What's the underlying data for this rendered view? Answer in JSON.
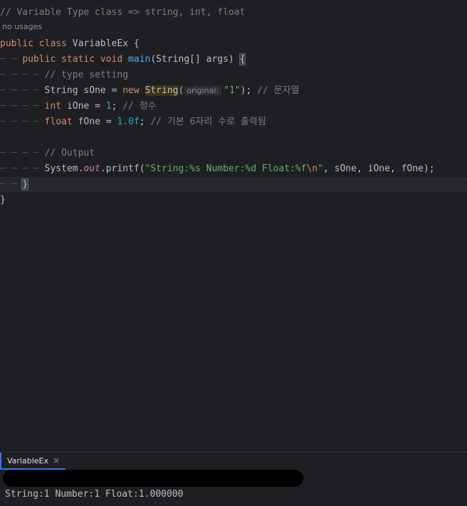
{
  "editor": {
    "usages_hint": "no usages",
    "lines": {
      "l1": "// Variable Type class => string, int, float",
      "l2_kw1": "public",
      "l2_kw2": "class",
      "l2_name": "VariableEx",
      "l2_brace": "{",
      "l3_kw1": "public",
      "l3_kw2": "static",
      "l3_kw3": "void",
      "l3_fn": "main",
      "l3_params": "(String[] args)",
      "l3_brace": "{",
      "l4_comment": "// type setting",
      "l5_type": "String",
      "l5_var": "sOne",
      "l5_eq": "=",
      "l5_new": "new",
      "l5_ctor": "String",
      "l5_open": "(",
      "l5_hint": "original:",
      "l5_str": "\"1\"",
      "l5_close": ");",
      "l5_comment": "// 문자열",
      "l6_type": "int",
      "l6_var": "iOne",
      "l6_eq": "=",
      "l6_num": "1",
      "l6_semi": ";",
      "l6_comment": "// 정수",
      "l7_type": "float",
      "l7_var": "fOne",
      "l7_eq": "=",
      "l7_num": "1.0f",
      "l7_semi": ";",
      "l7_comment": "// 기본 6자리 수로 출력됨",
      "l9_comment": "// Output",
      "l10_obj": "System.",
      "l10_field": "out",
      "l10_method": ".printf(",
      "l10_str1": "\"String:%s Number:%d Float:%f",
      "l10_esc": "\\n",
      "l10_str2": "\"",
      "l10_args": ", sOne, iOne, fOne);",
      "l11_brace": "}",
      "l12_brace": "}"
    }
  },
  "run_panel": {
    "tab_label": "VariableEx",
    "close_icon": "×",
    "output": "String:1 Number:1 Float:1.000000"
  }
}
